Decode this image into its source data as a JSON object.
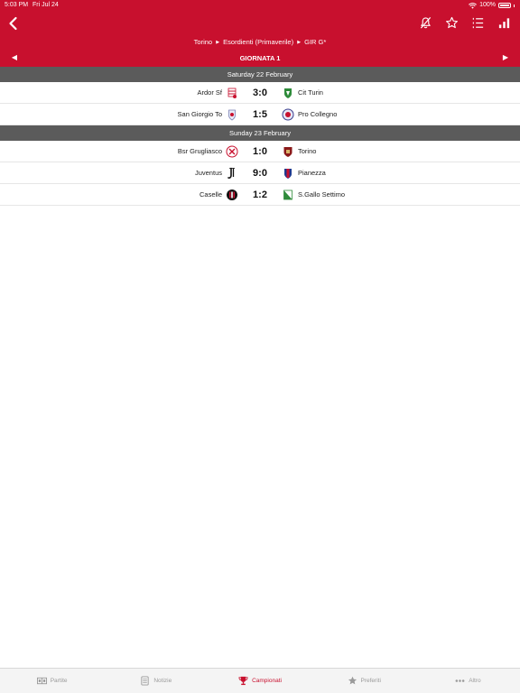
{
  "status_bar": {
    "time": "5:03 PM",
    "date": "Fri Jul 24",
    "battery": "100%"
  },
  "nav": {
    "back_icon": "chevron-left-icon",
    "icons": [
      "bell-slash-icon",
      "star-outline-icon",
      "list-icon",
      "bar-chart-icon"
    ]
  },
  "breadcrumb": [
    "Torino",
    "Esordienti (Primaverile)",
    "GIR G*"
  ],
  "round": {
    "title": "GIORNATA 1",
    "prev": "◀",
    "next": "▶"
  },
  "days": [
    {
      "label": "Saturday 22 February",
      "matches": [
        {
          "home": "Ardor Sf",
          "score": "3:0",
          "away": "Cit Turin"
        },
        {
          "home": "San Giorgio To",
          "score": "1:5",
          "away": "Pro Collegno"
        }
      ]
    },
    {
      "label": "Sunday 23 February",
      "matches": [
        {
          "home": "Bsr Grugliasco",
          "score": "1:0",
          "away": "Torino"
        },
        {
          "home": "Juventus",
          "score": "9:0",
          "away": "Pianezza"
        },
        {
          "home": "Caselle",
          "score": "1:2",
          "away": "S.Gallo Settimo"
        }
      ]
    }
  ],
  "tabs": [
    {
      "label": "Partite",
      "icon": "scoreboard-icon",
      "active": false
    },
    {
      "label": "Notizie",
      "icon": "news-icon",
      "active": false
    },
    {
      "label": "Campionati",
      "icon": "trophy-icon",
      "active": true
    },
    {
      "label": "Preferiti",
      "icon": "star-icon",
      "active": false
    },
    {
      "label": "Altro",
      "icon": "more-icon",
      "active": false
    }
  ],
  "colors": {
    "brand": "#c8102e",
    "day_header": "#5b5b5b",
    "tab_inactive": "#9a9a9a"
  }
}
